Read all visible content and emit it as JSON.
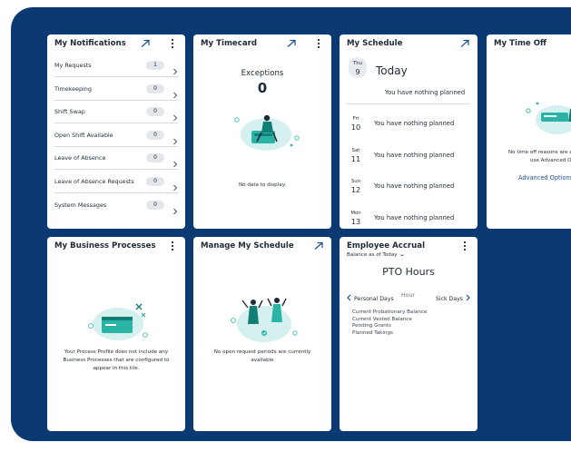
{
  "colors": {
    "background": "#0b3a73",
    "tile": "#ffffff",
    "accent": "#1a4f8c",
    "illustration_teal": "#2bb3a6",
    "illustration_light": "#d4f0ef"
  },
  "notifications": {
    "title": "My Notifications",
    "items": [
      {
        "label": "My Requests",
        "count": "1"
      },
      {
        "label": "Timekeeping",
        "count": "0"
      },
      {
        "label": "Shift Swap",
        "count": "0"
      },
      {
        "label": "Open Shift Available",
        "count": "0"
      },
      {
        "label": "Leave of Absence",
        "count": "0"
      },
      {
        "label": "Leave of Absence Requests",
        "count": "0"
      },
      {
        "label": "System Messages",
        "count": "0"
      }
    ]
  },
  "timecard": {
    "title": "My Timecard",
    "exceptions_label": "Exceptions",
    "exceptions_count": "0",
    "empty_text": "No data to display."
  },
  "schedule": {
    "title": "My Schedule",
    "today": {
      "dow": "Thu",
      "dom": "9",
      "label": "Today",
      "message": "You have nothing planned"
    },
    "days": [
      {
        "dow": "Fri",
        "dom": "10",
        "message": "You have nothing planned"
      },
      {
        "dow": "Sat",
        "dom": "11",
        "message": "You have nothing planned"
      },
      {
        "dow": "Sun",
        "dom": "12",
        "message": "You have nothing planned"
      },
      {
        "dow": "Mon",
        "dom": "13",
        "message": "You have nothing planned"
      }
    ]
  },
  "time_off": {
    "title": "My Time Off",
    "empty_line1": "No time off reasons are av",
    "empty_line2": "use Advanced Op",
    "advanced_link": "Advanced Options"
  },
  "business_processes": {
    "title": "My Business Processes",
    "empty_line1": "Your Process Profile does not include any",
    "empty_line2": "Business Processes that are configured to",
    "empty_line3": "appear in this tile."
  },
  "manage_schedule": {
    "title": "Manage My Schedule",
    "empty_line1": "No open request periods are currently",
    "empty_line2": "available"
  },
  "accrual": {
    "title": "Employee Accrual",
    "subtitle": "Balance as of Today",
    "heading": "PTO Hours",
    "prev_tab": "Personal Days",
    "unit": "Hour",
    "next_tab": "Sick Days",
    "lines": [
      "Current Probationary Balance",
      "Current Vested Balance",
      "Pending Grants",
      "Planned Takings"
    ]
  }
}
